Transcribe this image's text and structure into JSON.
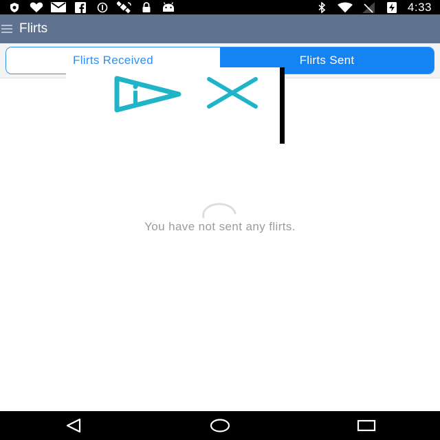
{
  "status_bar": {
    "left_icons": [
      "shield-icon",
      "heart-icon",
      "mail-icon",
      "facebook-icon",
      "info-icon",
      "satellite-icon",
      "lock-icon",
      "android-icon"
    ],
    "right_icons": [
      "bluetooth-icon",
      "wifi-icon",
      "no-signal-icon",
      "battery-charging-icon"
    ],
    "time": "4:33"
  },
  "app_bar": {
    "title": "Flirts",
    "background": "#5f7391"
  },
  "tabs": [
    {
      "label": "Flirts Received",
      "selected": false
    },
    {
      "label": "Flirts Sent",
      "selected": true
    }
  ],
  "accent_color": "#1484f5",
  "ad_overlay": {
    "icons": [
      "ad-play-icon",
      "ad-close-icon"
    ]
  },
  "empty_state": {
    "message": "You have not sent any flirts."
  },
  "nav_bar": {
    "buttons": [
      "back-icon",
      "home-icon",
      "recents-icon"
    ]
  }
}
